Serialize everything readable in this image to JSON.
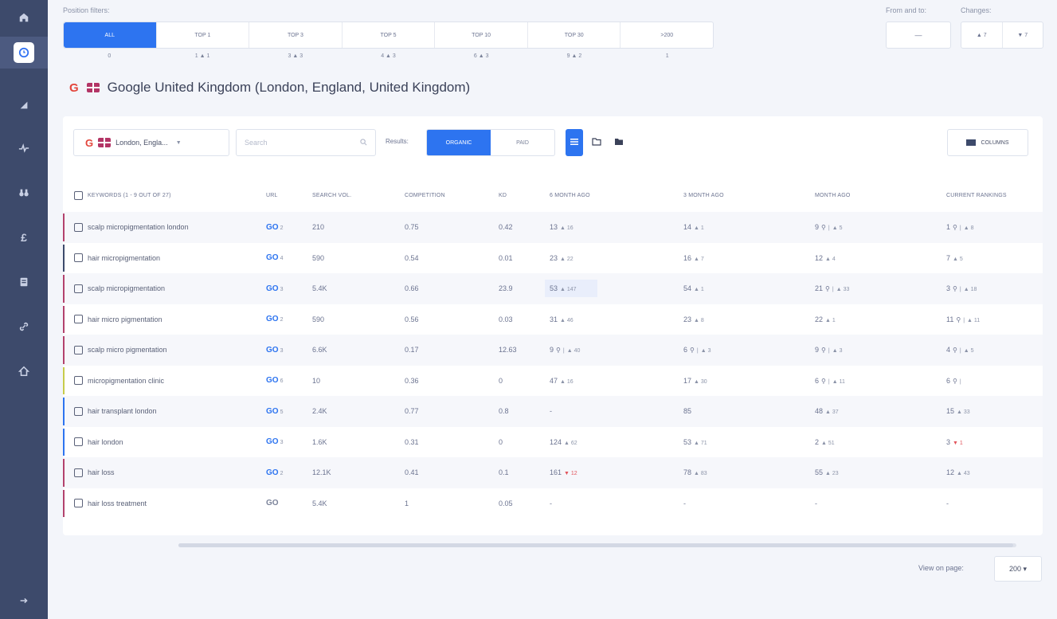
{
  "sidebar": {
    "items": [
      {
        "icon": "home-icon"
      },
      {
        "icon": "clock-icon",
        "active": true
      },
      {
        "icon": "chart-icon"
      },
      {
        "icon": "activity-icon"
      },
      {
        "icon": "binoculars-icon"
      },
      {
        "icon": "pound-icon"
      },
      {
        "icon": "report-icon"
      },
      {
        "icon": "link-icon"
      },
      {
        "icon": "house-icon"
      },
      {
        "icon": "arrow-right-icon"
      }
    ]
  },
  "filters": {
    "label": "Position filters:",
    "tabs": [
      {
        "label": "ALL",
        "count": "0"
      },
      {
        "label": "TOP 1",
        "count": "1 ▲ 1"
      },
      {
        "label": "TOP 3",
        "count": "3 ▲ 3"
      },
      {
        "label": "TOP 5",
        "count": "4 ▲ 3"
      },
      {
        "label": "TOP 10",
        "count": "6 ▲ 3"
      },
      {
        "label": "TOP 30",
        "count": "9 ▲ 2"
      },
      {
        "label": ">200",
        "count": "1"
      }
    ],
    "from_label": "From and to:",
    "from_value": "—",
    "changes_label": "Changes:",
    "changes_values": [
      "▲ 7",
      "▼ 7"
    ]
  },
  "engine": {
    "g": "G",
    "title": "Google United Kingdom (London, England, United Kingdom)"
  },
  "toolbar": {
    "location": "London, Engla...",
    "caret": "▼",
    "search_placeholder": "Search",
    "results_label": "Results:",
    "organic": "ORGANIC",
    "paid": "PAID",
    "columns": "COLUMNS"
  },
  "table": {
    "headers": {
      "keywords": "KEYWORDS (1 - 9 OUT OF 27)",
      "url": "URL",
      "search_vol": "SEARCH VOL.",
      "competition": "COMPETITION",
      "kd": "KD",
      "m6": "6 MONTH AGO",
      "m3": "3 MONTH AGO",
      "m1": "MONTH AGO",
      "current": "CURRENT RANKINGS"
    },
    "rows": [
      {
        "keyword": "scalp micropigmentation london",
        "url_n": "2",
        "sv": "210",
        "comp": "0.75",
        "kd": "0.42",
        "m6": "13",
        "m6c": "▲ 16",
        "m3": "14",
        "m3c": "▲ 1",
        "m1": "9",
        "m1c": "▲ 5",
        "cur": "1",
        "curc": "▲ 8",
        "m1pin": true,
        "curpin": true,
        "bar": "#b3426d"
      },
      {
        "keyword": "hair micropigmentation",
        "url_n": "4",
        "sv": "590",
        "comp": "0.54",
        "kd": "0.01",
        "m6": "23",
        "m6c": "▲ 22",
        "m3": "16",
        "m3c": "▲ 7",
        "m1": "12",
        "m1c": "▲ 4",
        "cur": "7",
        "curc": "▲ 5",
        "bar": "#3d4a6b"
      },
      {
        "keyword": "scalp micropigmentation",
        "url_n": "3",
        "sv": "5.4K",
        "comp": "0.66",
        "kd": "23.9",
        "m6": "53",
        "m6c": "▲ 147",
        "m6hl": true,
        "m3": "54",
        "m3c": "▲ 1",
        "m1": "21",
        "m1c": "▲ 33",
        "cur": "3",
        "curc": "▲ 18",
        "m1pin": true,
        "curpin": true,
        "bar": "#b3426d"
      },
      {
        "keyword": "hair micro pigmentation",
        "url_n": "2",
        "sv": "590",
        "comp": "0.56",
        "kd": "0.03",
        "m6": "31",
        "m6c": "▲ 46",
        "m3": "23",
        "m3c": "▲ 8",
        "m1": "22",
        "m1c": "▲ 1",
        "cur": "11",
        "curc": "▲ 11",
        "curpin": true,
        "bar": "#b3426d"
      },
      {
        "keyword": "scalp micro pigmentation",
        "url_n": "3",
        "sv": "6.6K",
        "comp": "0.17",
        "kd": "12.63",
        "m6": "9",
        "m6c": "▲ 40",
        "m6pin": true,
        "m3": "6",
        "m3c": "▲ 3",
        "m3pin": true,
        "m1": "9",
        "m1c": "▲ 3",
        "m1pin": true,
        "cur": "4",
        "curc": "▲ 5",
        "curpin": true,
        "bar": "#b3426d"
      },
      {
        "keyword": "micropigmentation clinic",
        "url_n": "6",
        "sv": "10",
        "comp": "0.36",
        "kd": "0",
        "m6": "47",
        "m6c": "▲ 16",
        "m3": "17",
        "m3c": "▲ 30",
        "m1": "6",
        "m1c": "▲ 11",
        "m1pin": true,
        "cur": "6",
        "curc": "",
        "curpin": true,
        "bar": "#c7cc4a"
      },
      {
        "keyword": "hair transplant london",
        "url_n": "5",
        "sv": "2.4K",
        "comp": "0.77",
        "kd": "0.8",
        "m6": "-",
        "m6c": "",
        "m3": "85",
        "m3c": "",
        "m1": "48",
        "m1c": "▲ 37",
        "cur": "15",
        "curc": "▲ 33",
        "bar": "#2d74f0"
      },
      {
        "keyword": "hair london",
        "url_n": "3",
        "sv": "1.6K",
        "comp": "0.31",
        "kd": "0",
        "m6": "124",
        "m6c": "▲ 62",
        "m3": "53",
        "m3c": "▲ 71",
        "m1": "2",
        "m1c": "▲ 51",
        "cur": "3",
        "curc": "▼ 1",
        "curred": true,
        "bar": "#2d74f0"
      },
      {
        "keyword": "hair loss",
        "url_n": "2",
        "sv": "12.1K",
        "comp": "0.41",
        "kd": "0.1",
        "m6": "161",
        "m6c": "▼ 12",
        "m6red": true,
        "m3": "78",
        "m3c": "▲ 83",
        "m1": "55",
        "m1c": "▲ 23",
        "cur": "12",
        "curc": "▲ 43",
        "bar": "#b3426d"
      },
      {
        "keyword": "hair loss treatment",
        "url_n": "",
        "sv": "5.4K",
        "comp": "1",
        "kd": "0.05",
        "m6": "-",
        "m6c": "",
        "m3": "-",
        "m3c": "",
        "m1": "-",
        "m1c": "",
        "cur": "-",
        "curc": "",
        "greylink": true,
        "bar": "#b3426d"
      }
    ]
  },
  "footer": {
    "view_label": "View on page:",
    "view_value": "200 ▾"
  },
  "colors": {
    "accent": "#2d74f0",
    "sidebar": "#3d4a6b",
    "negative": "#e2545b"
  }
}
